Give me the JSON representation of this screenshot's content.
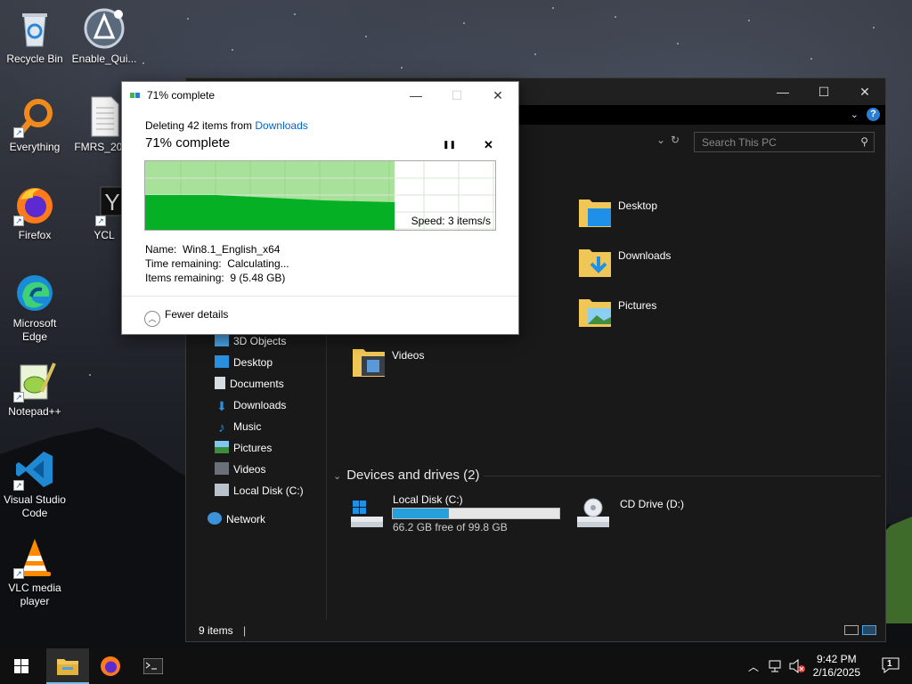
{
  "desktop": {
    "icons": [
      {
        "label": "Recycle Bin",
        "icon": "recycle-bin-icon"
      },
      {
        "label": "Enable_Qui...",
        "icon": "app-icon"
      },
      {
        "label": "Everything",
        "icon": "search-app-icon"
      },
      {
        "label": "FMRS_2025",
        "icon": "document-icon"
      },
      {
        "label": "Firefox",
        "icon": "firefox-icon"
      },
      {
        "label": "YCL",
        "icon": "text-file-icon",
        "glyph": "Y"
      },
      {
        "label": "Microsoft Edge",
        "icon": "edge-icon"
      },
      {
        "label": "Notepad++",
        "icon": "notepadpp-icon"
      },
      {
        "label": "Visual Studio Code",
        "icon": "vscode-icon"
      },
      {
        "label": "VLC media player",
        "icon": "vlc-icon"
      }
    ]
  },
  "explorer": {
    "title_buttons": {
      "minimize": "—",
      "maximize": "☐",
      "close": "✕"
    },
    "ribbon": {
      "expand": "⌄",
      "help": "?"
    },
    "address": {
      "dropdown": "⌄",
      "refresh": "↻"
    },
    "search": {
      "placeholder": "Search This PC"
    },
    "nav": [
      {
        "label": "3D Objects",
        "icon": "3d-objects-icon"
      },
      {
        "label": "Desktop",
        "icon": "desktop-icon"
      },
      {
        "label": "Documents",
        "icon": "documents-icon"
      },
      {
        "label": "Downloads",
        "icon": "downloads-icon"
      },
      {
        "label": "Music",
        "icon": "music-icon"
      },
      {
        "label": "Pictures",
        "icon": "pictures-icon"
      },
      {
        "label": "Videos",
        "icon": "videos-icon"
      },
      {
        "label": "Local Disk (C:)",
        "icon": "local-disk-icon"
      },
      {
        "label": "Network",
        "icon": "network-icon"
      }
    ],
    "folders": [
      {
        "label": "Desktop"
      },
      {
        "label": "Downloads"
      },
      {
        "label": "Pictures"
      },
      {
        "label": "Videos"
      }
    ],
    "devices_header": "Devices and drives (2)",
    "drives": [
      {
        "label": "Local Disk (C:)",
        "free": "66.2 GB free of 99.8 GB",
        "used_fraction": 0.337
      },
      {
        "label": "CD Drive (D:)"
      }
    ],
    "status": "9 items"
  },
  "dialog": {
    "title": "71% complete",
    "subtitle_prefix": "Deleting 42 items from ",
    "subtitle_link": "Downloads",
    "headline": "71% complete",
    "pause_glyph": "❚❚",
    "close_glyph": "✕",
    "window_close": "✕",
    "window_maximize": "☐",
    "window_minimize": "—",
    "speed": "Speed: 3 items/s",
    "progress_fraction": 0.71,
    "info": [
      {
        "label": "Name:",
        "value": "Win8.1_English_x64"
      },
      {
        "label": "Time remaining:",
        "value": "Calculating..."
      },
      {
        "label": "Items remaining:",
        "value": "9 (5.48 GB)"
      }
    ],
    "fewer_details": "Fewer details",
    "fewer_details_glyph": "︿"
  },
  "taskbar": {
    "time": "9:42 PM",
    "date": "2/16/2025",
    "notification_count": "1",
    "tray_up": "︿"
  },
  "colors": {
    "progress_green": "#06b025",
    "progress_light": "#a8e29a",
    "drive_fill": "#26a0da",
    "link_blue": "#0066cc"
  }
}
